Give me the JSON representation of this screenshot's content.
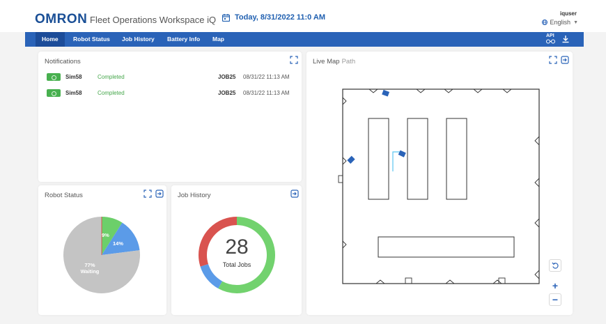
{
  "header": {
    "logo": "OMRON",
    "app_title": "Fleet Operations Workspace iQ",
    "date": "Today, 8/31/2022 11:0 AM",
    "user": "iquser",
    "language": "English"
  },
  "nav": {
    "tabs": [
      {
        "label": "Home",
        "active": true
      },
      {
        "label": "Robot Status",
        "active": false
      },
      {
        "label": "Job History",
        "active": false
      },
      {
        "label": "Battery Info",
        "active": false
      },
      {
        "label": "Map",
        "active": false
      }
    ],
    "api_label": "API"
  },
  "notifications": {
    "title": "Notifications",
    "rows": [
      {
        "robot": "Sim58",
        "status": "Completed",
        "job": "JOB25",
        "time": "08/31/22 11:13 AM"
      },
      {
        "robot": "Sim58",
        "status": "Completed",
        "job": "JOB25",
        "time": "08/31/22 11:13 AM"
      }
    ]
  },
  "robot_status": {
    "title": "Robot Status",
    "slices": [
      {
        "label": "9%",
        "value": 9,
        "color": "#6ccf6a"
      },
      {
        "label": "14%",
        "value": 14,
        "color": "#5b9be8"
      },
      {
        "label": "77%",
        "sublabel": "Waiting",
        "value": 77,
        "color": "#c4c4c4"
      }
    ]
  },
  "job_history": {
    "title": "Job History",
    "total": "28",
    "total_label": "Total Jobs",
    "segments": [
      {
        "value": 58,
        "color": "#72d26e"
      },
      {
        "value": 12,
        "color": "#5b9be8"
      },
      {
        "value": 30,
        "color": "#d9534f"
      }
    ]
  },
  "live_map": {
    "title": "Live Map",
    "subtitle": "Path"
  },
  "colors": {
    "nav_bg": "#2a63b8",
    "brand": "#1a4f96",
    "success": "#44a64a"
  }
}
